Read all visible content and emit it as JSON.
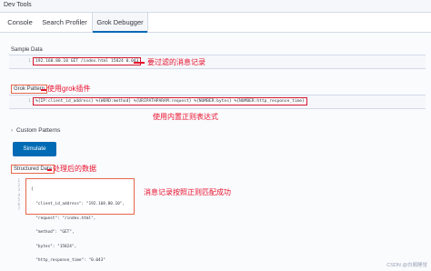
{
  "app": {
    "title": "Dev Tools"
  },
  "tabs": [
    {
      "label": "Console"
    },
    {
      "label": "Search Profiler"
    },
    {
      "label": "Grok Debugger"
    }
  ],
  "sample": {
    "label": "Sample Data",
    "line_numbers": [
      "1"
    ],
    "code": "192.168.80.10 GET /index.html 15824 0.043",
    "annotation": "要过滤的消息记录"
  },
  "grok": {
    "label": "Grok Pattern",
    "line_numbers": [
      "1"
    ],
    "code": "%{IP:client_id_address} %{WORD:method} %{URIPATHPARAM:request} %{NUMBER:bytes} %{NUMBER:http_response_time}",
    "annotation_label": "使用grok插件",
    "annotation_code": "使用内置正则表达式"
  },
  "custom_patterns": {
    "label": "Custom Patterns"
  },
  "simulate_button": {
    "label": "Simulate"
  },
  "structured": {
    "label": "Structured Data",
    "annotation_label": "处理后的数据",
    "annotation_json": "消息记录按照正则匹配成功",
    "line_numbers": [
      "1",
      "2",
      "3",
      "4",
      "5",
      "6",
      "7"
    ],
    "lines": [
      "{",
      "  \"client_id_address\": \"192.168.80.10\",",
      "  \"request\": \"/index.html\",",
      "  \"method\": \"GET\",",
      "  \"bytes\": \"15824\",",
      "  \"http_response_time\": \"0.043\"",
      "}"
    ]
  },
  "watermark": "CSDN @白阁睡觉"
}
